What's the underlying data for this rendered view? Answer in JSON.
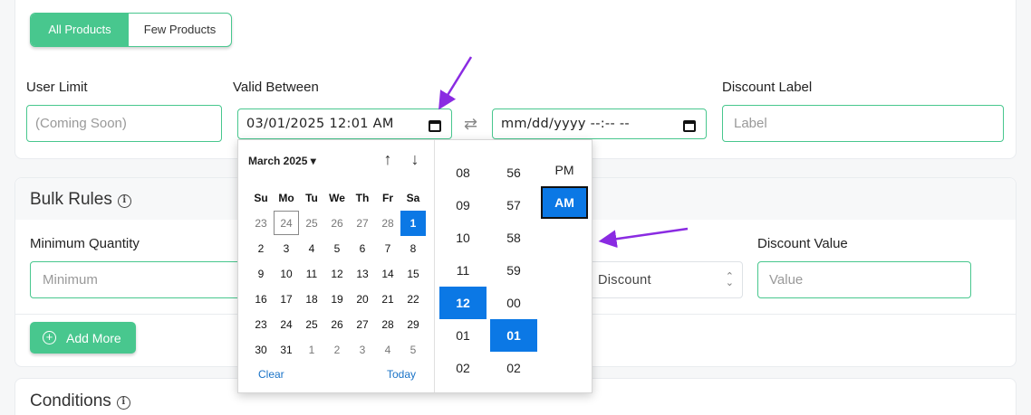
{
  "product_toggle": {
    "all_label": "All Products",
    "few_label": "Few Products"
  },
  "fields": {
    "user_limit": {
      "label": "User Limit",
      "placeholder": "(Coming Soon)"
    },
    "valid_between": {
      "label": "Valid Between",
      "start_value": "03/01/2025 12:01 AM",
      "end_placeholder": "mm/dd/yyyy --:-- --"
    },
    "discount_label": {
      "label": "Discount Label",
      "placeholder": "Label"
    }
  },
  "bulk_rules": {
    "title": "Bulk Rules",
    "min_qty": {
      "label": "Minimum Quantity",
      "placeholder": "Minimum"
    },
    "discount_type": {
      "value": "Discount"
    },
    "discount_value": {
      "label": "Discount Value",
      "placeholder": "Value"
    },
    "add_more": "Add More"
  },
  "conditions": {
    "title": "Conditions"
  },
  "picker": {
    "month_label": "March 2025 ▾",
    "nav_up": "↑",
    "nav_down": "↓",
    "weekdays": [
      "Su",
      "Mo",
      "Tu",
      "We",
      "Th",
      "Fr",
      "Sa"
    ],
    "days": [
      [
        "23",
        "24",
        "25",
        "26",
        "27",
        "28",
        "1"
      ],
      [
        "2",
        "3",
        "4",
        "5",
        "6",
        "7",
        "8"
      ],
      [
        "9",
        "10",
        "11",
        "12",
        "13",
        "14",
        "15"
      ],
      [
        "16",
        "17",
        "18",
        "19",
        "20",
        "21",
        "22"
      ],
      [
        "23",
        "24",
        "25",
        "26",
        "27",
        "28",
        "29"
      ],
      [
        "30",
        "31",
        "1",
        "2",
        "3",
        "4",
        "5"
      ]
    ],
    "clear": "Clear",
    "today": "Today",
    "hours": [
      "08",
      "09",
      "10",
      "11",
      "12",
      "01",
      "02"
    ],
    "minutes": [
      "56",
      "57",
      "58",
      "59",
      "00",
      "01",
      "02"
    ],
    "pm": "PM",
    "am": "AM"
  },
  "colors": {
    "accent": "#48c78e",
    "selected": "#0b78e5",
    "annotation": "#8a2be2"
  }
}
